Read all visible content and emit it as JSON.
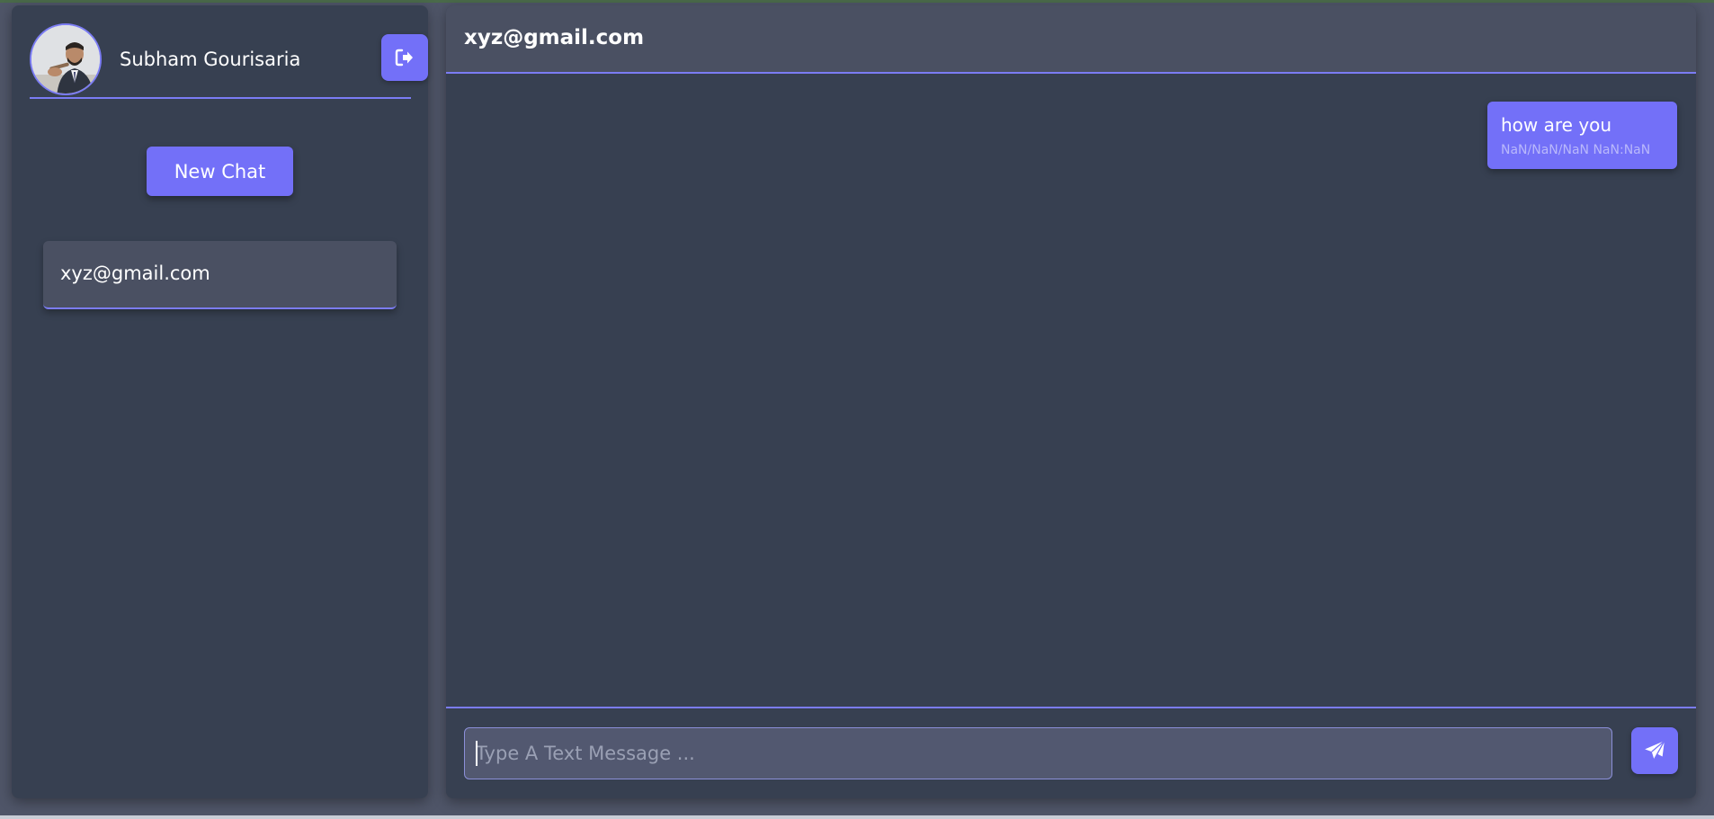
{
  "user": {
    "name": "Subham Gourisaria",
    "avatar_icon": "user-photo-avatar",
    "logout_icon": "logout-icon"
  },
  "sidebar": {
    "new_chat_label": "New Chat",
    "contacts": [
      {
        "label": "xyz@gmail.com"
      }
    ]
  },
  "chat": {
    "title": "xyz@gmail.com",
    "messages": [
      {
        "text": "how are you",
        "timestamp": "NaN/NaN/NaN NaN:NaN",
        "sender": "self"
      }
    ],
    "input": {
      "value": "",
      "placeholder": "Type A Text Message ..."
    },
    "send_icon": "paper-plane-icon"
  },
  "colors": {
    "accent": "#7370f8",
    "panel": "#374051",
    "header": "#4a5062",
    "background": "#4f5568"
  }
}
